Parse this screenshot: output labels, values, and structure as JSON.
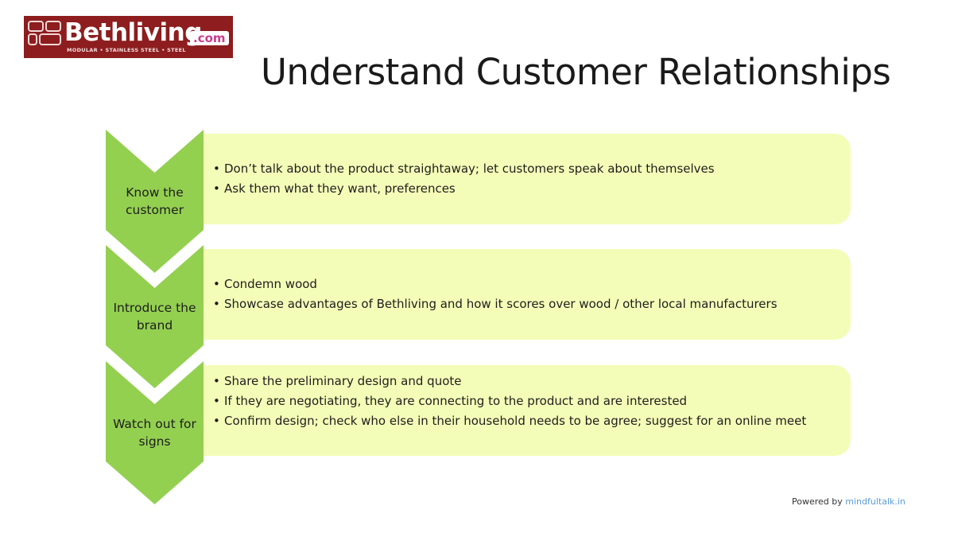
{
  "logo": {
    "wordmark": "Bethliving",
    "domain": ".com",
    "tagline": "MODULAR • STAINLESS STEEL • STEEL"
  },
  "title": "Understand Customer Relationships",
  "rows": [
    {
      "label": "Know the customer",
      "bullets": [
        "Don’t talk about the product straightaway; let customers speak about themselves",
        "Ask them what they want, preferences"
      ]
    },
    {
      "label": "Introduce the brand",
      "bullets": [
        "Condemn wood",
        "Showcase advantages of Bethliving and how it scores over wood / other local manufacturers"
      ]
    },
    {
      "label": "Watch out for signs",
      "bullets": [
        "Share the preliminary design and quote",
        "If they are negotiating, they are connecting to the product and are interested",
        "Confirm design; check who else in their household needs to be agree; suggest for an online meet"
      ]
    }
  ],
  "bullet_glyph": "•",
  "footer": {
    "powered_by": "Powered by",
    "link": "mindfultalk.in"
  },
  "colors": {
    "chevron": "#93d050",
    "panel": "#f4fdb7",
    "logo_bg": "#8d1d1e",
    "link": "#5b9bd5"
  }
}
